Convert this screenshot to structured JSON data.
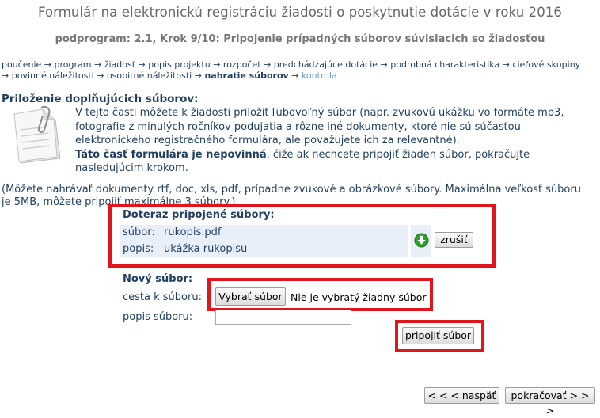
{
  "page": {
    "title": "Formulár na elektronickú registráciu žiadosti o poskytnutie dotácie v roku 2016",
    "subtitle": "podprogram: 2.1, Krok 9/10: Pripojenie prípadných súborov súvisiacich so žiadosťou"
  },
  "nav": {
    "steps": [
      "poučenie",
      "program",
      "žiadosť",
      "popis projektu",
      "rozpočet",
      "predchádzajúce dotácie",
      "podrobná charakteristika",
      "cieľové skupiny",
      "povinné náležitosti",
      "osobitné náležitosti",
      "nahratie súborov",
      "kontrola"
    ],
    "arrow": "→"
  },
  "section": {
    "heading": "Priloženie doplňujúcich súborov:",
    "intro_1": "V tejto časti môžete k žiadosti priložiť ľubovoľný súbor (napr. zvukovú ukážku vo formáte mp3, fotografie z minulých ročníkov podujatia a rôzne iné dokumenty, ktoré nie sú súčasťou elektronického registračného formulára, ale považujete ich za relevantné).",
    "intro_bold": "Táto časť formulára je nepovinná",
    "intro_2": ", čiže ak nechcete pripojiť žiaden súbor, pokračujte nasledujúcim krokom.",
    "note": "(Môžete nahrávať dokumenty rtf, doc, xls, pdf, prípadne zvukové a obrázkové súbory. Maximálna veľkosť súboru je 5MB, môžete pripojiť maximálne 3 súbory.)"
  },
  "attached": {
    "heading": "Doteraz pripojené súbory:",
    "file_label": "súbor:",
    "file_value": "rukopis.pdf",
    "desc_label": "popis:",
    "desc_value": "ukážka rukopisu",
    "cancel_label": "zrušiť"
  },
  "new_file": {
    "heading": "Nový súbor:",
    "path_label": "cesta k súboru:",
    "choose_label": "Vybrať súbor",
    "no_file_text": "Nie je vybratý žiadny súbor",
    "desc_label": "popis súboru:",
    "desc_value": "",
    "attach_label": "pripojiť súbor"
  },
  "footer": {
    "back_label": "< < <  naspäť",
    "next_label": "pokračovať > > >"
  },
  "colors": {
    "text": "#1f3f5f",
    "highlight_box": "#e2141c",
    "row_bg": "#e9eff8",
    "future_step": "#6a9ccc",
    "download_icon": "#2e9e2e"
  },
  "icons": {
    "document": "document-with-paperclip-icon",
    "download": "download-arrow-icon"
  }
}
